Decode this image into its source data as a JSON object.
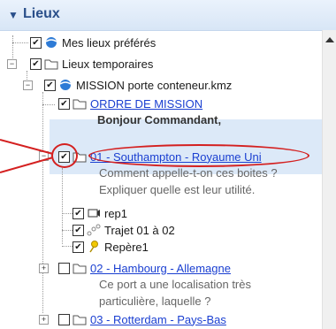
{
  "panel": {
    "title": "Lieux"
  },
  "tree": {
    "favorites": {
      "label": "Mes lieux préférés",
      "checked": true
    },
    "temporary": {
      "label": "Lieux temporaires",
      "checked": true
    },
    "mission_file": {
      "label": "MISSION porte conteneur.kmz",
      "checked": true
    },
    "ordre": {
      "label": "ORDRE DE MISSION",
      "desc": "Bonjour Commandant,",
      "checked": true
    },
    "southampton": {
      "label": "01 - Southampton - Royaume Uni",
      "desc1": "Comment appelle-t-on ces boites ?",
      "desc2": "Expliquer quelle est leur utilité.",
      "checked": true
    },
    "rep1": {
      "label": "rep1",
      "checked": true
    },
    "trajet": {
      "label": "Trajet 01 à 02",
      "checked": true
    },
    "repere1": {
      "label": "Repère1",
      "checked": true
    },
    "hambourg": {
      "label": "02 - Hambourg - Allemagne",
      "desc1": "Ce port a une localisation très",
      "desc2": "particulière, laquelle ?",
      "checked": false
    },
    "rotterdam": {
      "label": "03 - Rotterdam - Pays-Bas",
      "checked": false
    }
  },
  "colors": {
    "link": "#1a3fd1",
    "selection": "#dce9f8",
    "annotation": "#d42020",
    "header_text": "#2a4f8a"
  }
}
